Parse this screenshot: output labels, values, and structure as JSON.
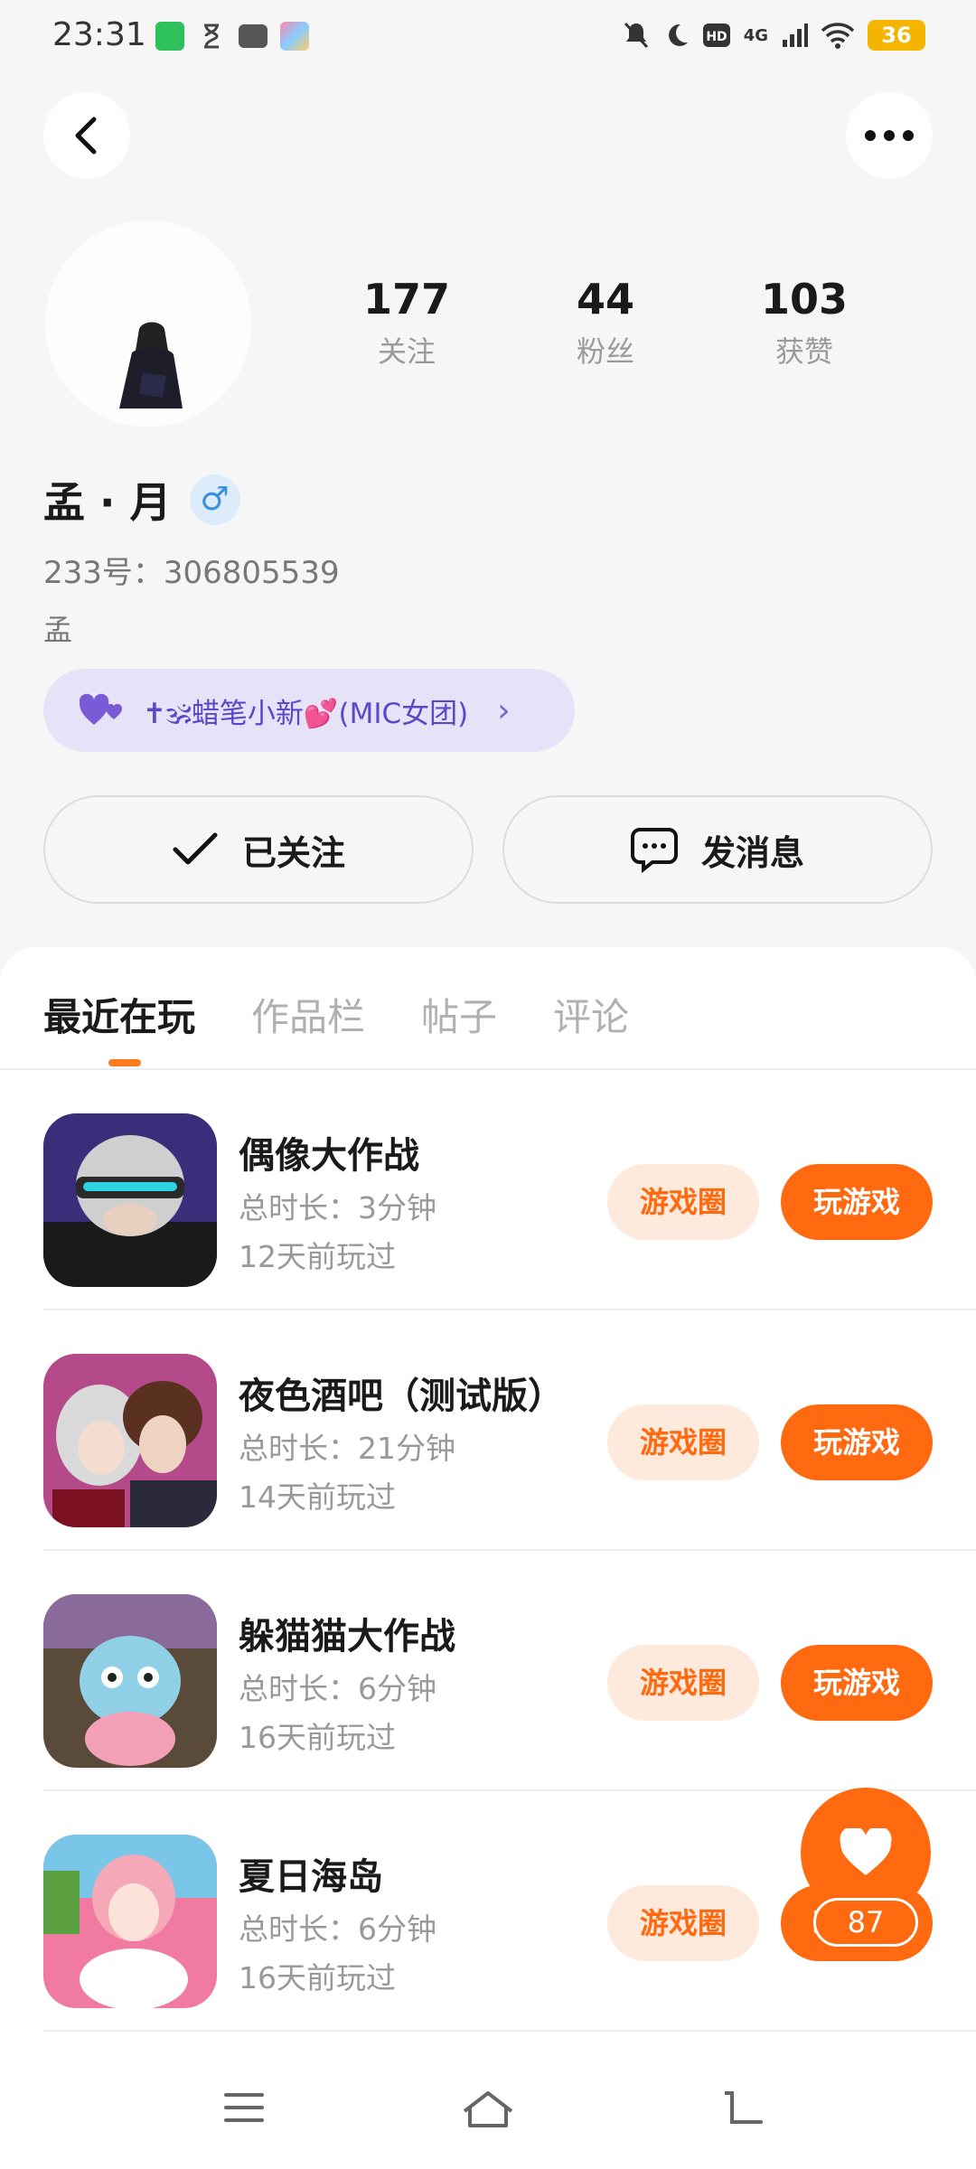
{
  "status_bar": {
    "time": "23:31",
    "battery": "36",
    "network": "4G"
  },
  "profile": {
    "stats": [
      {
        "value": "177",
        "label": "关注"
      },
      {
        "value": "44",
        "label": "粉丝"
      },
      {
        "value": "103",
        "label": "获赞"
      }
    ],
    "name": "孟 · 月",
    "gender_symbol": "♂",
    "uid": "233号：306805539",
    "bio": "孟",
    "group": "✝🕉蜡笔小新💕(MIC女团)",
    "group_chevron": "›",
    "follow_label": "已关注",
    "message_label": "发消息"
  },
  "tabs": [
    {
      "label": "最近在玩",
      "active": true
    },
    {
      "label": "作品栏",
      "active": false
    },
    {
      "label": "帖子",
      "active": false
    },
    {
      "label": "评论",
      "active": false
    }
  ],
  "games": [
    {
      "title": "偶像大作战",
      "duration": "总时长：3分钟",
      "last_played": "12天前玩过",
      "circle_label": "游戏圈",
      "play_label": "玩游戏"
    },
    {
      "title": "夜色酒吧（测试版）",
      "duration": "总时长：21分钟",
      "last_played": "14天前玩过",
      "circle_label": "游戏圈",
      "play_label": "玩游戏"
    },
    {
      "title": "躲猫猫大作战",
      "duration": "总时长：6分钟",
      "last_played": "16天前玩过",
      "circle_label": "游戏圈",
      "play_label": "玩游戏"
    },
    {
      "title": "夏日海岛",
      "duration": "总时长：6分钟",
      "last_played": "16天前玩过",
      "circle_label": "游戏圈",
      "play_label": "玩游戏"
    }
  ],
  "like_fab": {
    "count": "87"
  },
  "colors": {
    "accent": "#ff6a10",
    "accent_light": "#fdeadd",
    "group_bg": "#e6e3f8"
  }
}
